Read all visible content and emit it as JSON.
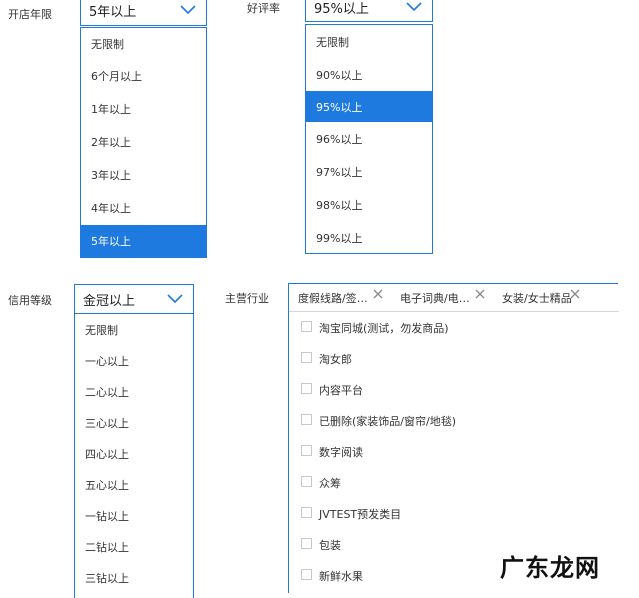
{
  "accent_color": "#1f7ae0",
  "shop_age": {
    "label": "开店年限",
    "value": "5年以上",
    "options": [
      "无限制",
      "6个月以上",
      "1年以上",
      "2年以上",
      "3年以上",
      "4年以上",
      "5年以上"
    ],
    "selected_index": 6
  },
  "rating": {
    "label": "好评率",
    "value": "95%以上",
    "options": [
      "无限制",
      "90%以上",
      "95%以上",
      "96%以上",
      "97%以上",
      "98%以上",
      "99%以上"
    ],
    "selected_index": 2
  },
  "credit": {
    "label": "信用等级",
    "value": "金冠以上",
    "options": [
      "无限制",
      "一心以上",
      "二心以上",
      "三心以上",
      "四心以上",
      "五心以上",
      "一钻以上",
      "二钻以上",
      "三钻以上"
    ]
  },
  "industry": {
    "label": "主营行业",
    "tags": [
      "度假线路/签…",
      "电子词典/电…",
      "女装/女士精品"
    ],
    "options": [
      "淘宝同城(测试，勿发商品)",
      "淘女郎",
      "内容平台",
      "已删除(家装饰品/窗帘/地毯)",
      "数字阅读",
      "众筹",
      "JVTEST预发类目",
      "包装",
      "新鲜水果"
    ]
  },
  "watermark": "广东龙网",
  "icons": {
    "chevron": "chevron-down-icon",
    "remove": "close-icon"
  }
}
